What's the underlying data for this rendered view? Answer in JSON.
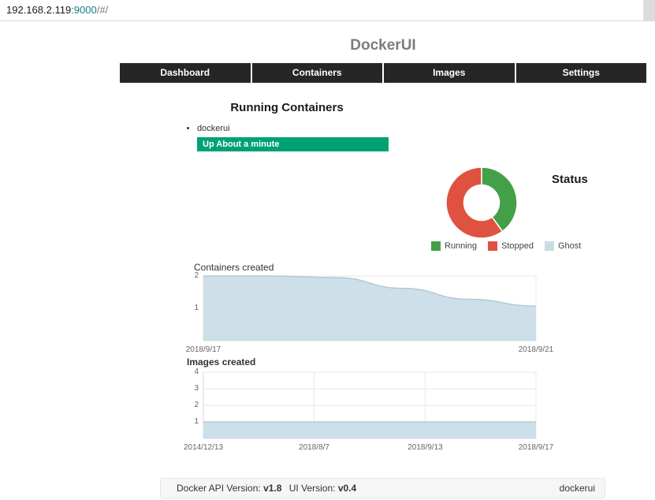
{
  "colors": {
    "accent_green": "#00a176",
    "nav_bg": "#262626",
    "running_green": "#43a047",
    "stopped_red": "#df5240",
    "ghost_blue": "#c9dde4",
    "area_fill": "#cddfe9",
    "area_line": "#b3c9d4"
  },
  "browser": {
    "url_host": "192.168.2.119",
    "url_port": ":9000",
    "url_path": "/#/"
  },
  "page": {
    "title": "DockerUI"
  },
  "nav": {
    "items": [
      "Dashboard",
      "Containers",
      "Images",
      "Settings"
    ]
  },
  "running_section": {
    "title": "Running Containers",
    "containers": [
      {
        "name": "dockerui",
        "status": "Up About a minute"
      }
    ]
  },
  "status_section": {
    "title": "Status",
    "legend": [
      "Running",
      "Stopped",
      "Ghost"
    ]
  },
  "containers_chart": {
    "label": "Containers created"
  },
  "images_chart": {
    "label": "Images created"
  },
  "footer": {
    "api_label": "Docker API Version:",
    "api_version": "v1.8",
    "ui_label": "UI Version:",
    "ui_version": "v0.4",
    "brand": "dockerui"
  },
  "chart_data": [
    {
      "type": "pie",
      "title": "Status",
      "labels": [
        "Running",
        "Stopped",
        "Ghost"
      ],
      "values": [
        2,
        3,
        0
      ],
      "colors": [
        "#43a047",
        "#df5240",
        "#c9dde4"
      ],
      "legend_position": "bottom",
      "note": "doughnut; green ~40%, red ~60%, ghost 0"
    },
    {
      "type": "area",
      "title": "Containers created",
      "x_labels": [
        {
          "label": "2018/9/17",
          "pos": 0
        },
        {
          "label": "2018/9/21",
          "pos": 1
        }
      ],
      "values": [
        2,
        2,
        1.95,
        1.62,
        1.28,
        1.07
      ],
      "ylim": [
        0,
        2
      ],
      "y_ticks": [
        2,
        1
      ],
      "fill": "#cddfe9",
      "line": "#b3c9d4",
      "grid": true
    },
    {
      "type": "area",
      "title": "Images created",
      "x_labels": [
        {
          "label": "2014/12/13",
          "pos": 0
        },
        {
          "label": "2018/8/7",
          "pos": 0.333
        },
        {
          "label": "2018/9/13",
          "pos": 0.667
        },
        {
          "label": "2018/9/17",
          "pos": 1
        }
      ],
      "values": [
        1,
        1,
        1,
        1
      ],
      "ylim": [
        0,
        4
      ],
      "y_ticks": [
        4,
        3,
        2,
        1
      ],
      "fill": "#cddfe9",
      "line": "#b3c9d4",
      "grid": true
    }
  ]
}
